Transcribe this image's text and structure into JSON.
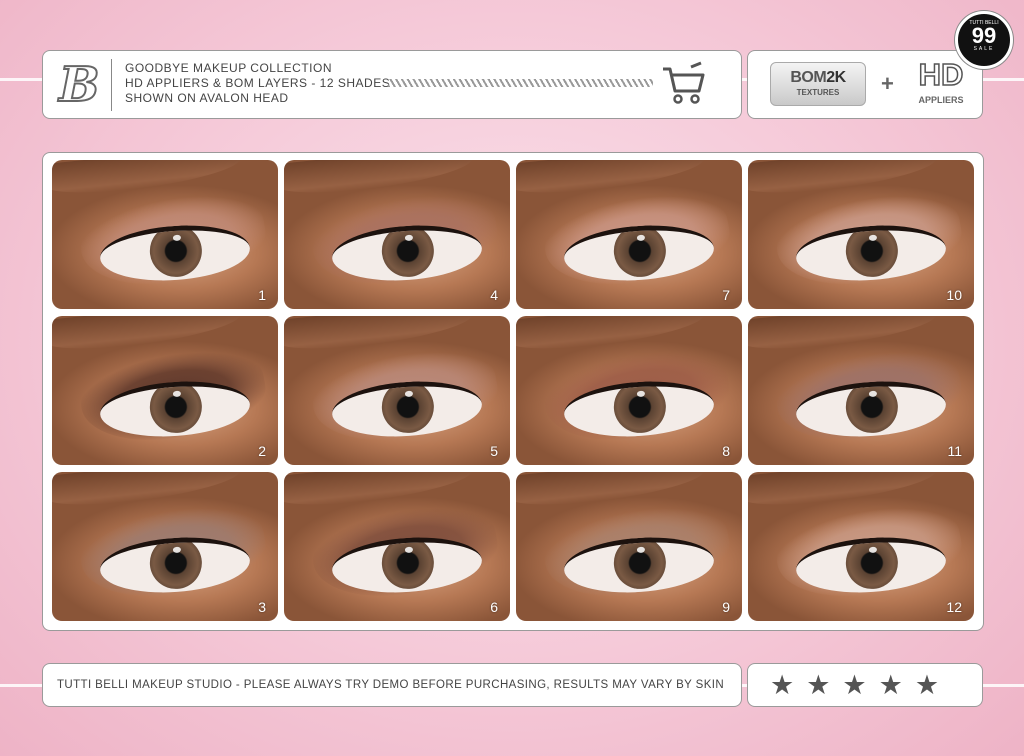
{
  "header": {
    "logo_letter": "B",
    "lines": [
      "GOODBYE MAKEUP COLLECTION",
      "HD APPLIERS & BOM LAYERS - 12 SHADES",
      "SHOWN ON AVALON HEAD"
    ],
    "cart_icon": "shopping-cart-icon"
  },
  "brand": {
    "bom_prefix": "BOM",
    "bom_suffix": "2K",
    "bom_sub": "TEXTURES",
    "plus": "+",
    "hd": "HD",
    "hd_sub": "APPLIERS"
  },
  "badge": {
    "top": "TUTTI BELLI",
    "number": "99",
    "label": "SALE"
  },
  "shades": [
    {
      "number": "1",
      "shadow": "#c08a78",
      "liner": true
    },
    {
      "number": "4",
      "shadow": "#a87060",
      "liner": true
    },
    {
      "number": "7",
      "shadow": "#c89484",
      "liner": false
    },
    {
      "number": "10",
      "shadow": "#c99a8a",
      "liner": false
    },
    {
      "number": "2",
      "shadow": "#5a3428",
      "liner": false
    },
    {
      "number": "5",
      "shadow": "#b8887a",
      "liner": false
    },
    {
      "number": "8",
      "shadow": "#9a5a46",
      "liner": false
    },
    {
      "number": "11",
      "shadow": "#9a7068",
      "liner": false
    },
    {
      "number": "3",
      "shadow": "#9a7a70",
      "liner": false
    },
    {
      "number": "6",
      "shadow": "#7a4a3a",
      "liner": true
    },
    {
      "number": "9",
      "shadow": "#a8806c",
      "liner": false
    },
    {
      "number": "12",
      "shadow": "#c89a86",
      "liner": true
    }
  ],
  "footer": {
    "text": "TUTTI BELLI MAKEUP STUDIO - PLEASE ALWAYS TRY DEMO BEFORE PURCHASING, RESULTS MAY VARY BY SKIN"
  },
  "rating": {
    "stars": 5,
    "glyphs": "★★★★★"
  },
  "colors": {
    "background": "#f5c9d8",
    "panel": "#ffffff",
    "text": "#444444"
  }
}
